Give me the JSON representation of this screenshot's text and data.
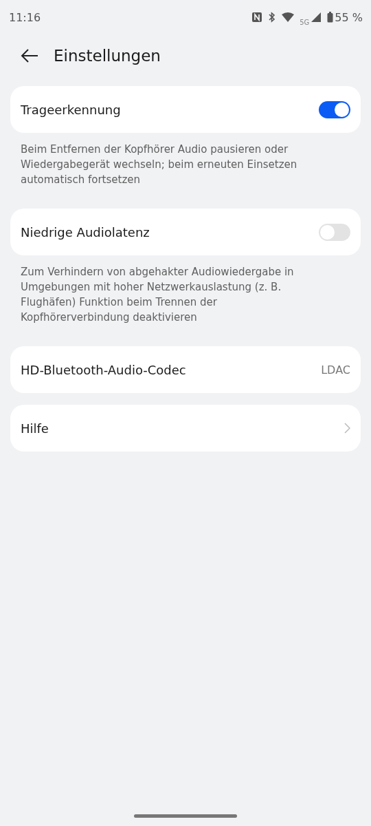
{
  "status_bar": {
    "time": "11:16",
    "network": "5G",
    "battery": "55 %"
  },
  "header": {
    "title": "Einstellungen"
  },
  "items": [
    {
      "kind": "toggle",
      "label": "Trageerkennung",
      "on": true,
      "description": "Beim Entfernen der Kopfhörer Audio pausieren oder Wiedergabegerät wechseln; beim erneuten Einsetzen automatisch fortsetzen"
    },
    {
      "kind": "toggle",
      "label": "Niedrige Audiolatenz",
      "on": false,
      "description": "Zum Verhindern von abgehakter Audiowiedergabe in Umgebungen mit hoher Netzwerkauslastung (z. B. Flughäfen) Funktion beim Trennen der Kopfhörerverbindung deaktivieren"
    },
    {
      "kind": "value",
      "label": "HD-Bluetooth-Audio-Codec",
      "value": "LDAC"
    },
    {
      "kind": "link",
      "label": "Hilfe"
    }
  ]
}
